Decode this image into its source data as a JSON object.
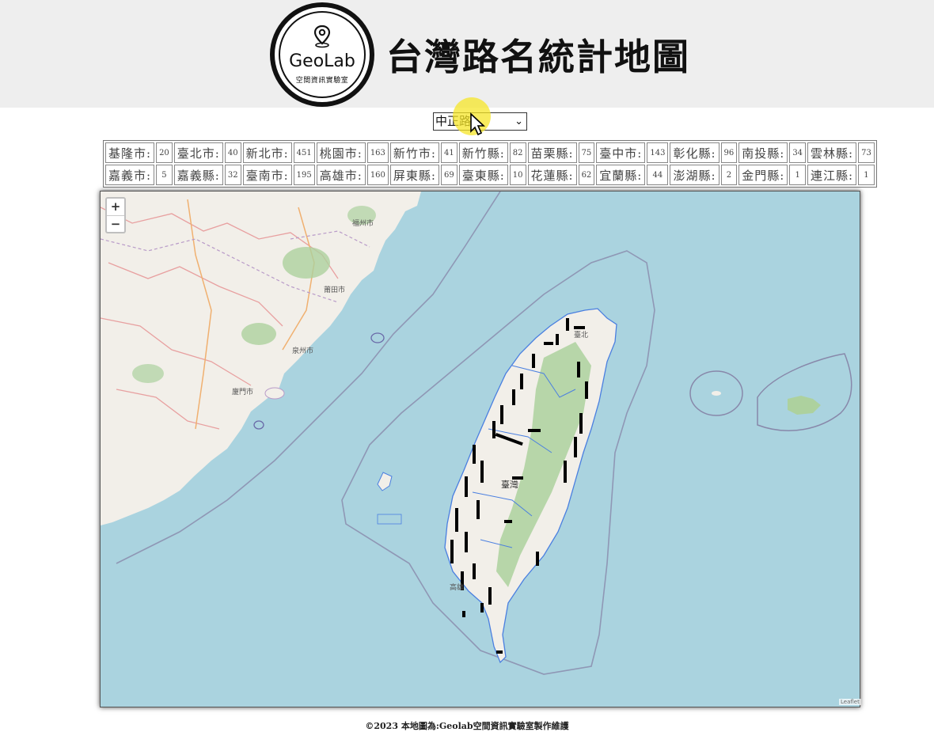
{
  "header": {
    "logo_text": "GeoLab",
    "logo_subtitle": "空間資訊實驗室",
    "title": "台灣路名統計地圖"
  },
  "road_select": {
    "selected": "中正路"
  },
  "counts": [
    [
      {
        "name": "基隆市:",
        "count": "20"
      },
      {
        "name": "臺北市:",
        "count": "40"
      },
      {
        "name": "新北市:",
        "count": "451"
      },
      {
        "name": "桃園市:",
        "count": "163"
      },
      {
        "name": "新竹市:",
        "count": "41"
      },
      {
        "name": "新竹縣:",
        "count": "82"
      },
      {
        "name": "苗栗縣:",
        "count": "75"
      },
      {
        "name": "臺中市:",
        "count": "143"
      },
      {
        "name": "彰化縣:",
        "count": "96"
      },
      {
        "name": "南投縣:",
        "count": "34"
      },
      {
        "name": "雲林縣:",
        "count": "73"
      }
    ],
    [
      {
        "name": "嘉義市:",
        "count": "5"
      },
      {
        "name": "嘉義縣:",
        "count": "32"
      },
      {
        "name": "臺南市:",
        "count": "195"
      },
      {
        "name": "高雄市:",
        "count": "160"
      },
      {
        "name": "屏東縣:",
        "count": "69"
      },
      {
        "name": "臺東縣:",
        "count": "10"
      },
      {
        "name": "花蓮縣:",
        "count": "62"
      },
      {
        "name": "宜蘭縣:",
        "count": "44"
      },
      {
        "name": "澎湖縣:",
        "count": "2"
      },
      {
        "name": "金門縣:",
        "count": "1"
      },
      {
        "name": "連江縣:",
        "count": "1"
      }
    ]
  ],
  "map": {
    "zoom_in": "+",
    "zoom_out": "−",
    "attribution": "Leaflet",
    "labels": {
      "fuzhou": "福州市",
      "xiamen": "廈門市",
      "putian": "莆田市",
      "quanzhou": "泉州市",
      "taipei": "臺北",
      "taiwan": "臺灣",
      "kaohsiung": "高雄"
    },
    "colors": {
      "sea": "#aad3df",
      "land": "#f2efe9",
      "forest": "#add19e",
      "boundary": "#4a7fe0",
      "road_marks": "#000000"
    }
  },
  "footer": "©2023 本地圖為:Geolab空間資訊實驗室製作維護"
}
